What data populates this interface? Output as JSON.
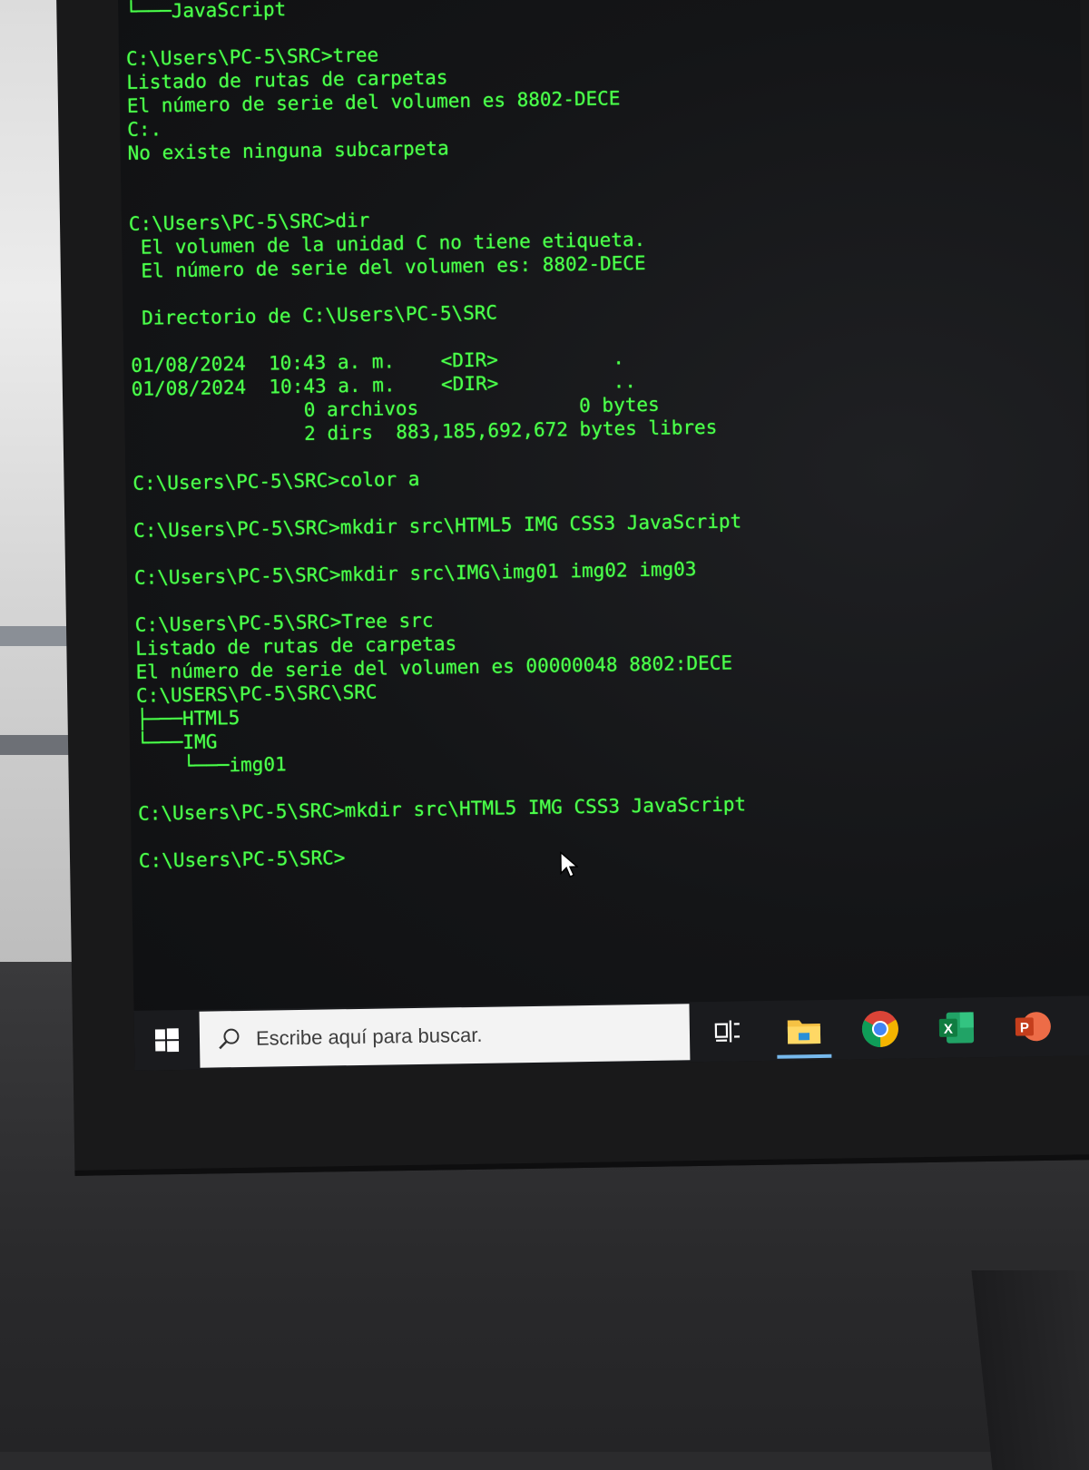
{
  "console": {
    "lines": [
      "└───JavaScript",
      "",
      "C:\\Users\\PC-5\\SRC>tree",
      "Listado de rutas de carpetas",
      "El número de serie del volumen es 8802-DECE",
      "C:.",
      "No existe ninguna subcarpeta",
      "",
      "",
      "C:\\Users\\PC-5\\SRC>dir",
      " El volumen de la unidad C no tiene etiqueta.",
      " El número de serie del volumen es: 8802-DECE",
      "",
      " Directorio de C:\\Users\\PC-5\\SRC",
      "",
      "01/08/2024  10:43 a. m.    <DIR>          .",
      "01/08/2024  10:43 a. m.    <DIR>          ..",
      "               0 archivos              0 bytes",
      "               2 dirs  883,185,692,672 bytes libres",
      "",
      "C:\\Users\\PC-5\\SRC>color a",
      "",
      "C:\\Users\\PC-5\\SRC>mkdir src\\HTML5 IMG CSS3 JavaScript",
      "",
      "C:\\Users\\PC-5\\SRC>mkdir src\\IMG\\img01 img02 img03",
      "",
      "C:\\Users\\PC-5\\SRC>Tree src",
      "Listado de rutas de carpetas",
      "El número de serie del volumen es 00000048 8802:DECE",
      "C:\\USERS\\PC-5\\SRC\\SRC",
      "├───HTML5",
      "└───IMG",
      "    └───img01",
      "",
      "C:\\Users\\PC-5\\SRC>mkdir src\\HTML5 IMG CSS3 JavaScript",
      "",
      "C:\\Users\\PC-5\\SRC>"
    ]
  },
  "taskbar": {
    "search_placeholder": "Escribe aquí para buscar.",
    "icons": [
      "windows-start-icon",
      "search-icon",
      "task-view-icon",
      "file-explorer-icon",
      "chrome-icon",
      "excel-icon",
      "powerpoint-icon"
    ]
  },
  "colors": {
    "console_text": "#4dff4d",
    "console_bg": "#141517",
    "taskbar": "#1a1b1e",
    "search_box": "#f3f3f3",
    "active_indicator": "#76b9ed"
  }
}
